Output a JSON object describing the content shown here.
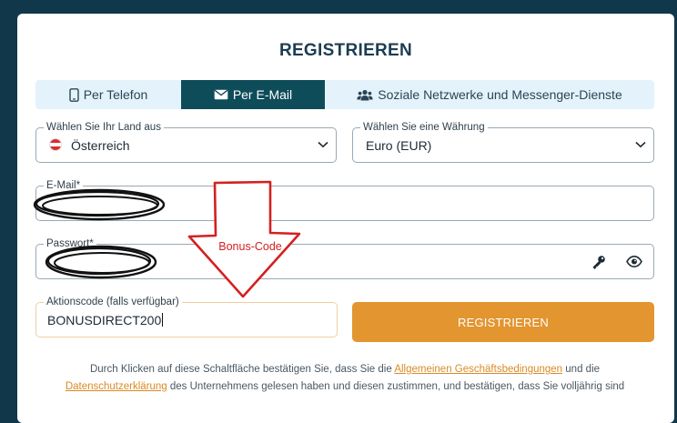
{
  "page": {
    "title": "REGISTRIEREN"
  },
  "tabs": [
    {
      "label": "Per Telefon",
      "icon": "phone-icon",
      "active": false
    },
    {
      "label": "Per E-Mail",
      "icon": "envelope-icon",
      "active": true
    },
    {
      "label": "Soziale Netzwerke und Messenger-Dienste",
      "icon": "users-icon",
      "active": false
    }
  ],
  "form": {
    "country": {
      "label": "Wählen Sie Ihr Land aus",
      "value": "Österreich",
      "icon": "austria-flag-icon"
    },
    "currency": {
      "label": "Wählen Sie eine Währung",
      "value": "Euro (EUR)"
    },
    "email": {
      "label": "E-Mail*",
      "value": ""
    },
    "password": {
      "label": "Passwort*",
      "value": ""
    },
    "promo": {
      "label": "Aktionscode (falls verfügbar)",
      "value": "BONUSDIRECT200"
    },
    "submit_label": "REGISTRIEREN"
  },
  "annotation": {
    "label": "Bonus-Code"
  },
  "terms": {
    "part1": "Durch Klicken auf diese Schaltfläche bestätigen Sie, dass Sie die ",
    "link1": "Allgemeinen Geschäftsbedingungen",
    "part2": " und die",
    "link2": "Datenschutzerklärung",
    "part3": " des Unternehmens gelesen haben und diesen zustimmen, und bestätigen, dass Sie volljährig sind"
  },
  "colors": {
    "background": "#11384a",
    "active_tab": "#0e4c5a",
    "tab_bar": "#e4f3fb",
    "accent": "#e3952f",
    "link": "#d98b25",
    "annotation": "#d42020"
  }
}
